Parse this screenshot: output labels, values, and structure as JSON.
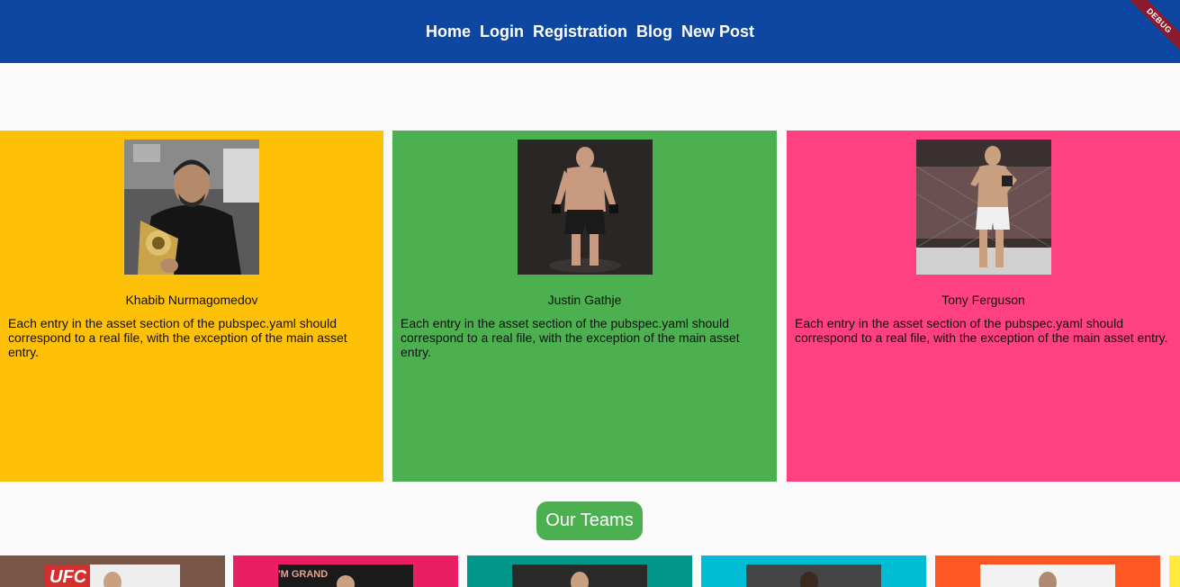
{
  "nav": {
    "items": [
      "Home",
      "Login",
      "Registration",
      "Blog",
      "New Post"
    ],
    "debug_label": "DEBUG"
  },
  "colors": {
    "appbar": "#0d47a1",
    "card_yellow": "#ffc107",
    "card_green": "#4caf50",
    "card_pink": "#ff4081",
    "button_green": "#4caf50"
  },
  "fighters": [
    {
      "name": "Khabib Nurmagomedov",
      "description": "Each entry in the asset section of the pubspec.yaml should correspond to a real file, with the exception of the main asset entry."
    },
    {
      "name": "Justin Gathje",
      "description": "Each entry in the asset section of the pubspec.yaml should correspond to a real file, with the exception of the main asset entry."
    },
    {
      "name": "Tony Ferguson",
      "description": "Each entry in the asset section of the pubspec.yaml should correspond to a real file, with the exception of the main asset entry."
    }
  ],
  "teams_button": "Our Teams",
  "team_colors": [
    "#795548",
    "#e91e63",
    "#009688",
    "#00bcd4",
    "#ff5722",
    "#ffeb3b"
  ]
}
